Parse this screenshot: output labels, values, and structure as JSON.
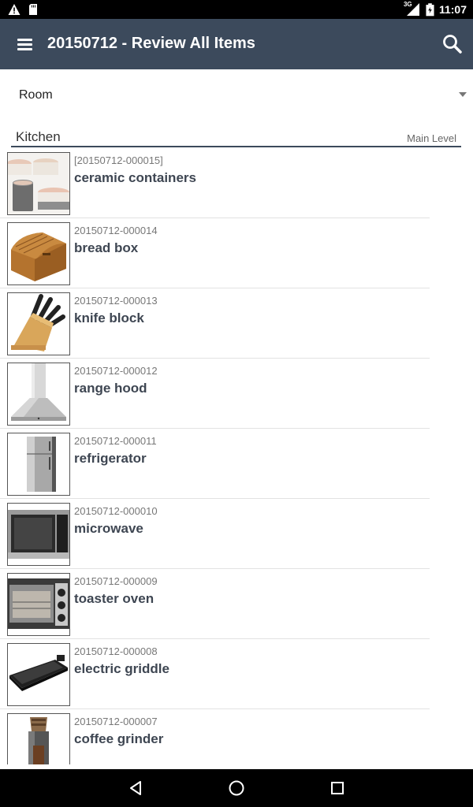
{
  "status_bar": {
    "time": "11:07",
    "network": "3G",
    "icons": [
      "warning-icon",
      "sd-card-icon",
      "signal-icon",
      "battery-icon"
    ]
  },
  "app_bar": {
    "title": "20150712 - Review All Items",
    "icons": [
      "menu-icon",
      "search-icon"
    ]
  },
  "filter": {
    "selected": "Room"
  },
  "section": {
    "title": "Kitchen",
    "subtitle": "Main Level"
  },
  "items": [
    {
      "id": "[20150712-000015]",
      "name": "ceramic containers",
      "icon": "ceramic-containers-photo"
    },
    {
      "id": "20150712-000014",
      "name": "bread box",
      "icon": "bread-box-photo"
    },
    {
      "id": "20150712-000013",
      "name": "knife block",
      "icon": "knife-block-photo"
    },
    {
      "id": "20150712-000012",
      "name": "range hood",
      "icon": "range-hood-photo"
    },
    {
      "id": "20150712-000011",
      "name": "refrigerator",
      "icon": "refrigerator-photo"
    },
    {
      "id": "20150712-000010",
      "name": "microwave",
      "icon": "microwave-photo"
    },
    {
      "id": "20150712-000009",
      "name": "toaster oven",
      "icon": "toaster-oven-photo"
    },
    {
      "id": "20150712-000008",
      "name": "electric griddle",
      "icon": "electric-griddle-photo"
    },
    {
      "id": "20150712-000007",
      "name": "coffee grinder",
      "icon": "coffee-grinder-photo"
    }
  ],
  "nav_bar": {
    "icons": [
      "back-icon",
      "home-icon",
      "recents-icon"
    ]
  },
  "colors": {
    "app_bar": "#3c4a5c",
    "item_name": "#3e4652",
    "item_id": "#777777"
  }
}
